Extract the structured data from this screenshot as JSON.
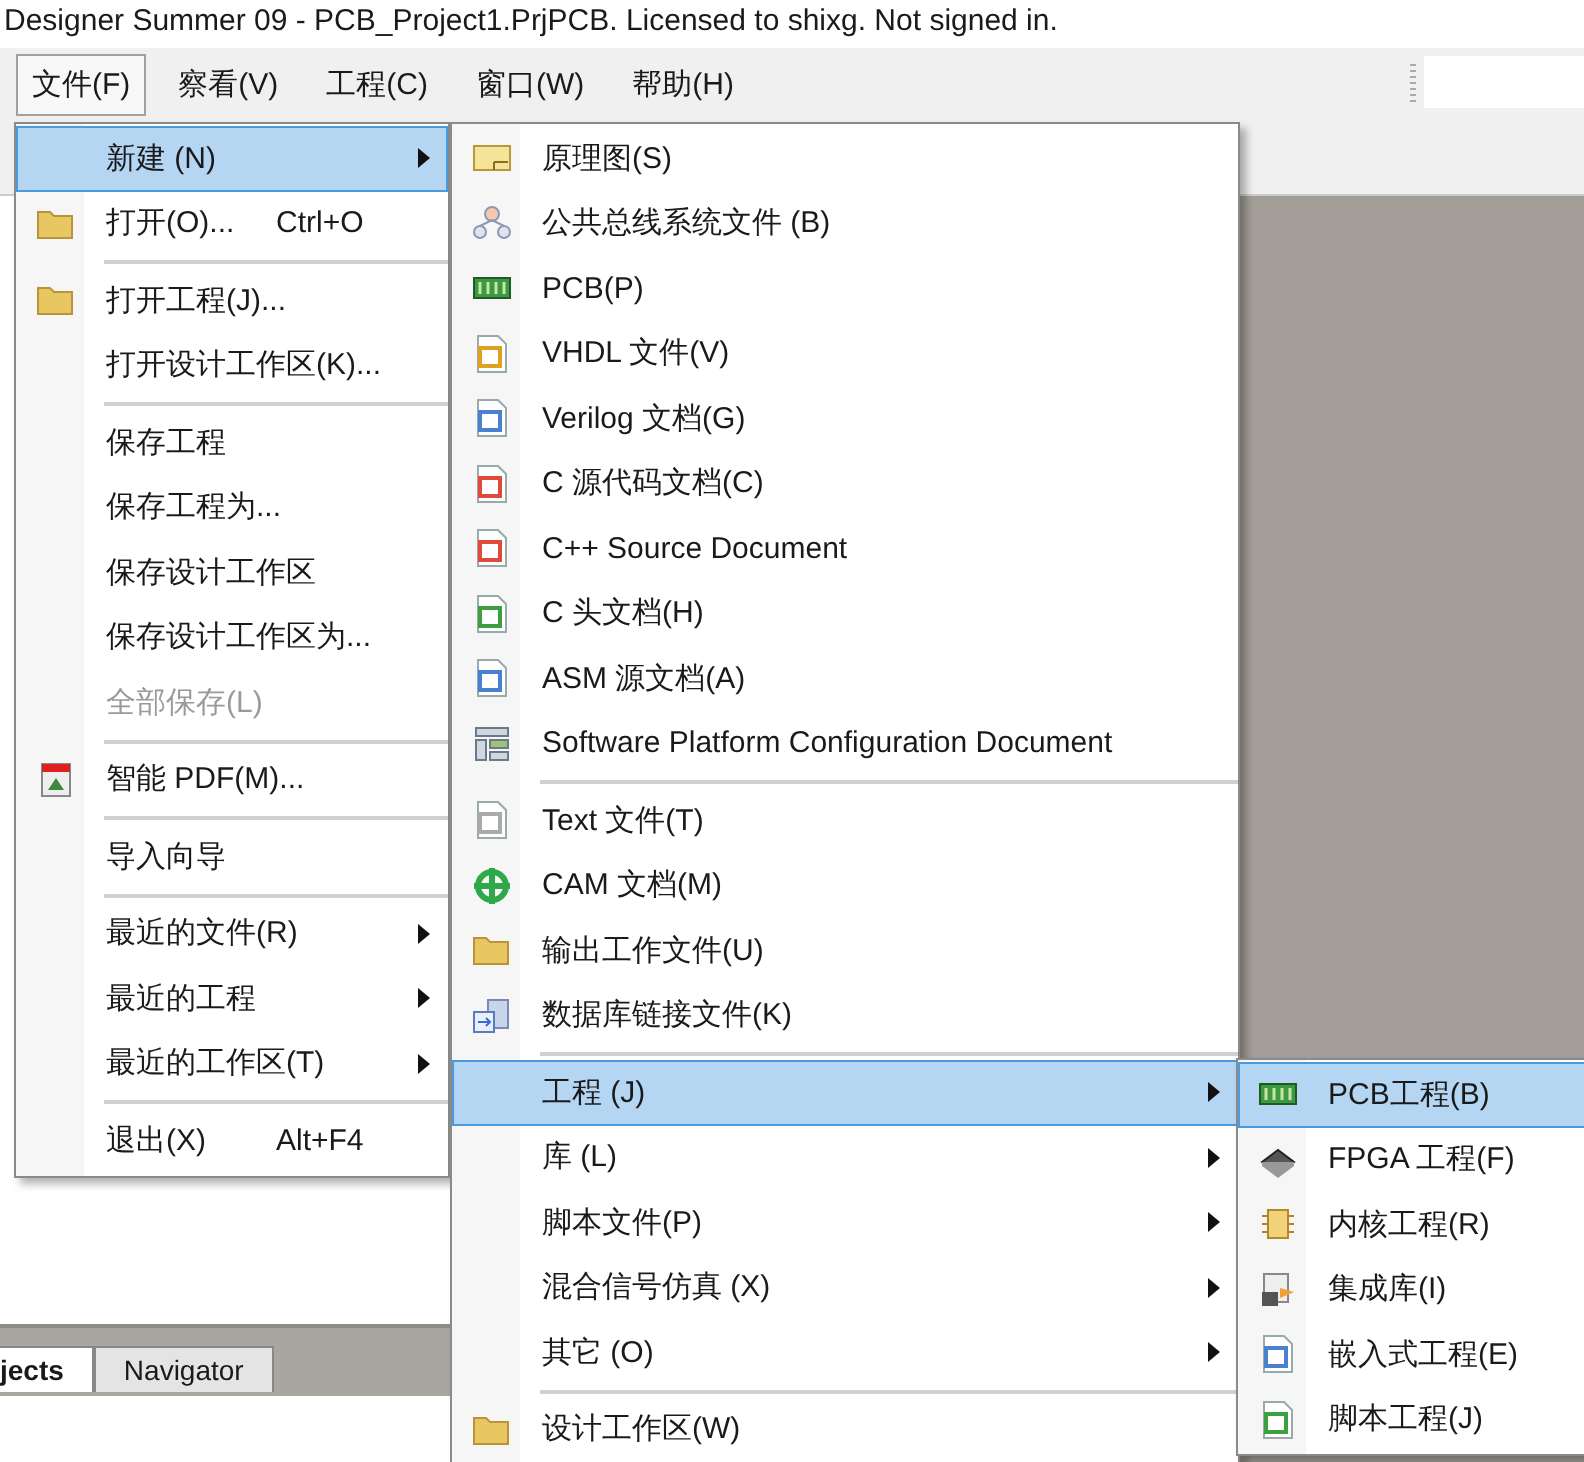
{
  "window": {
    "title": "Designer Summer 09 - PCB_Project1.PrjPCB. Licensed to shixg. Not signed in."
  },
  "menubar": [
    {
      "label": "文件(F)",
      "selected": true
    },
    {
      "label": "察看(V)",
      "selected": false
    },
    {
      "label": "工程(C)",
      "selected": false
    },
    {
      "label": "窗口(W)",
      "selected": false
    },
    {
      "label": "帮助(H)",
      "selected": false
    }
  ],
  "panel_tabs": [
    {
      "label": "jects",
      "selected": true
    },
    {
      "label": "Navigator",
      "selected": false
    }
  ],
  "file_menu": {
    "items": [
      {
        "kind": "item",
        "label": "新建 (N)",
        "submenu": true,
        "selected": true,
        "disabled": false
      },
      {
        "kind": "item",
        "label": "打开(O)...",
        "shortcut": "Ctrl+O",
        "submenu": false,
        "selected": false,
        "disabled": false
      },
      {
        "kind": "separator"
      },
      {
        "kind": "item",
        "label": "打开工程(J)...",
        "submenu": false,
        "selected": false,
        "disabled": false
      },
      {
        "kind": "item",
        "label": "打开设计工作区(K)...",
        "submenu": false,
        "selected": false,
        "disabled": false
      },
      {
        "kind": "separator"
      },
      {
        "kind": "item",
        "label": "保存工程",
        "submenu": false,
        "selected": false,
        "disabled": false
      },
      {
        "kind": "item",
        "label": "保存工程为...",
        "submenu": false,
        "selected": false,
        "disabled": false
      },
      {
        "kind": "item",
        "label": "保存设计工作区",
        "submenu": false,
        "selected": false,
        "disabled": false
      },
      {
        "kind": "item",
        "label": "保存设计工作区为...",
        "submenu": false,
        "selected": false,
        "disabled": false
      },
      {
        "kind": "item",
        "label": "全部保存(L)",
        "submenu": false,
        "selected": false,
        "disabled": true
      },
      {
        "kind": "separator"
      },
      {
        "kind": "item",
        "label": "智能 PDF(M)...",
        "submenu": false,
        "selected": false,
        "disabled": false
      },
      {
        "kind": "separator"
      },
      {
        "kind": "item",
        "label": "导入向导",
        "submenu": false,
        "selected": false,
        "disabled": false
      },
      {
        "kind": "separator"
      },
      {
        "kind": "item",
        "label": "最近的文件(R)",
        "submenu": true,
        "selected": false,
        "disabled": false
      },
      {
        "kind": "item",
        "label": "最近的工程",
        "submenu": true,
        "selected": false,
        "disabled": false
      },
      {
        "kind": "item",
        "label": "最近的工作区(T)",
        "submenu": true,
        "selected": false,
        "disabled": false
      },
      {
        "kind": "separator"
      },
      {
        "kind": "item",
        "label": "退出(X)",
        "shortcut": "Alt+F4",
        "submenu": false,
        "selected": false,
        "disabled": false
      }
    ]
  },
  "new_menu": {
    "items": [
      {
        "kind": "item",
        "label": "原理图(S)",
        "submenu": false,
        "selected": false,
        "disabled": false
      },
      {
        "kind": "item",
        "label": "公共总线系统文件 (B)",
        "submenu": false,
        "selected": false,
        "disabled": false
      },
      {
        "kind": "item",
        "label": "PCB(P)",
        "submenu": false,
        "selected": false,
        "disabled": false
      },
      {
        "kind": "item",
        "label": "VHDL 文件(V)",
        "submenu": false,
        "selected": false,
        "disabled": false
      },
      {
        "kind": "item",
        "label": "Verilog 文档(G)",
        "submenu": false,
        "selected": false,
        "disabled": false
      },
      {
        "kind": "item",
        "label": "C 源代码文档(C)",
        "submenu": false,
        "selected": false,
        "disabled": false
      },
      {
        "kind": "item",
        "label": "C++ Source Document",
        "submenu": false,
        "selected": false,
        "disabled": false
      },
      {
        "kind": "item",
        "label": "C 头文档(H)",
        "submenu": false,
        "selected": false,
        "disabled": false
      },
      {
        "kind": "item",
        "label": "ASM 源文档(A)",
        "submenu": false,
        "selected": false,
        "disabled": false
      },
      {
        "kind": "item",
        "label": "Software Platform Configuration Document",
        "submenu": false,
        "selected": false,
        "disabled": false
      },
      {
        "kind": "separator"
      },
      {
        "kind": "item",
        "label": "Text  文件(T)",
        "submenu": false,
        "selected": false,
        "disabled": false
      },
      {
        "kind": "item",
        "label": "CAM 文档(M)",
        "submenu": false,
        "selected": false,
        "disabled": false
      },
      {
        "kind": "item",
        "label": "输出工作文件(U)",
        "submenu": false,
        "selected": false,
        "disabled": false
      },
      {
        "kind": "item",
        "label": "数据库链接文件(K)",
        "submenu": false,
        "selected": false,
        "disabled": false
      },
      {
        "kind": "separator"
      },
      {
        "kind": "item",
        "label": "工程 (J)",
        "submenu": true,
        "selected": true,
        "disabled": false
      },
      {
        "kind": "item",
        "label": "库 (L)",
        "submenu": true,
        "selected": false,
        "disabled": false
      },
      {
        "kind": "item",
        "label": "脚本文件(P)",
        "submenu": true,
        "selected": false,
        "disabled": false
      },
      {
        "kind": "item",
        "label": "混合信号仿真 (X)",
        "submenu": true,
        "selected": false,
        "disabled": false
      },
      {
        "kind": "item",
        "label": "其它 (O)",
        "submenu": true,
        "selected": false,
        "disabled": false
      },
      {
        "kind": "separator"
      },
      {
        "kind": "item",
        "label": "设计工作区(W)",
        "submenu": false,
        "selected": false,
        "disabled": false
      }
    ]
  },
  "project_menu": {
    "items": [
      {
        "kind": "item",
        "label": "PCB工程(B)",
        "selected": true,
        "disabled": false
      },
      {
        "kind": "item",
        "label": "FPGA 工程(F)",
        "selected": false,
        "disabled": false
      },
      {
        "kind": "item",
        "label": "内核工程(R)",
        "selected": false,
        "disabled": false
      },
      {
        "kind": "item",
        "label": "集成库(I)",
        "selected": false,
        "disabled": false
      },
      {
        "kind": "item",
        "label": "嵌入式工程(E)",
        "selected": false,
        "disabled": false
      },
      {
        "kind": "item",
        "label": "脚本工程(J)",
        "selected": false,
        "disabled": false
      }
    ]
  }
}
